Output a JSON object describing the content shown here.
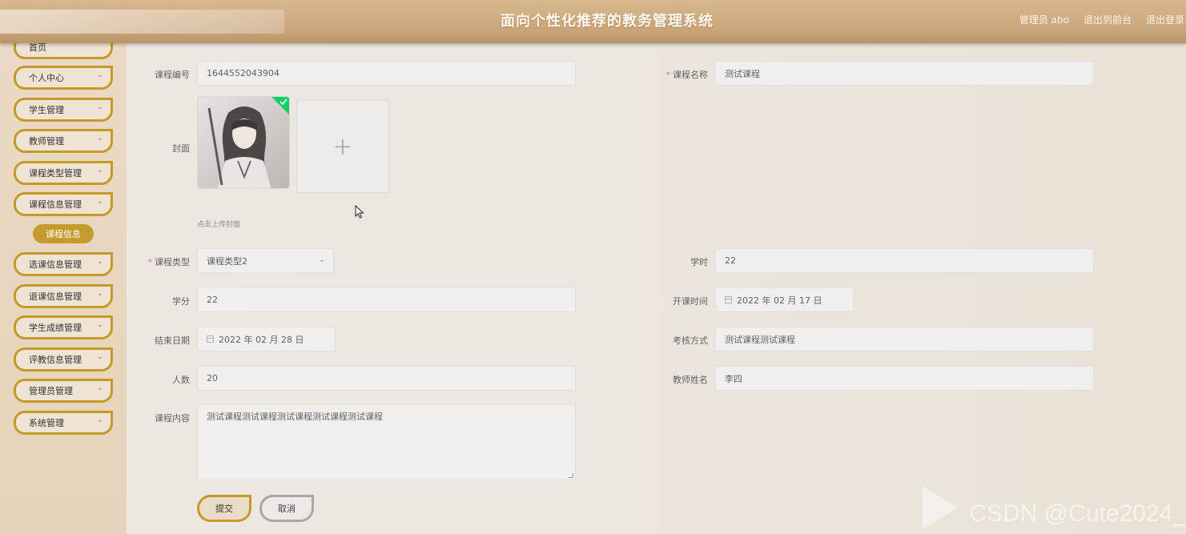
{
  "header": {
    "title": "面向个性化推荐的教务管理系统",
    "admin": "管理员 abo",
    "back_front": "退出到前台",
    "logout": "退出登录"
  },
  "sidebar": {
    "items": [
      {
        "label": "首页"
      },
      {
        "label": "个人中心"
      },
      {
        "label": "学生管理"
      },
      {
        "label": "教师管理"
      },
      {
        "label": "课程类型管理"
      },
      {
        "label": "课程信息管理"
      },
      {
        "label": "选课信息管理"
      },
      {
        "label": "退课信息管理"
      },
      {
        "label": "学生成绩管理"
      },
      {
        "label": "评教信息管理"
      },
      {
        "label": "管理员管理"
      },
      {
        "label": "系统管理"
      }
    ],
    "active_sub": "课程信息"
  },
  "form": {
    "course_no": {
      "label": "课程编号",
      "value": "1644552043904"
    },
    "course_name": {
      "label": "课程名称",
      "value": "测试课程"
    },
    "cover": {
      "label": "封面",
      "hint": "点击上传封面"
    },
    "course_type": {
      "label": "课程类型",
      "value": "课程类型2"
    },
    "hours": {
      "label": "学时",
      "value": "22"
    },
    "credits": {
      "label": "学分",
      "value": "22"
    },
    "start_date": {
      "label": "开课时间",
      "value": "2022 年 02 月 17 日"
    },
    "end_date": {
      "label": "结束日期",
      "value": "2022 年 02 月 28 日"
    },
    "assessment": {
      "label": "考核方式",
      "value": "测试课程测试课程"
    },
    "count": {
      "label": "人数",
      "value": "20"
    },
    "teacher": {
      "label": "教师姓名",
      "value": "李四"
    },
    "content": {
      "label": "课程内容",
      "value": "测试课程测试课程测试课程测试课程测试课程"
    }
  },
  "buttons": {
    "submit": "提交",
    "cancel": "取消"
  },
  "watermark": "CSDN @Cute2024_",
  "colors": {
    "accent": "#c49a2a",
    "header": "#d2ae84",
    "required": "#f56c6c"
  }
}
